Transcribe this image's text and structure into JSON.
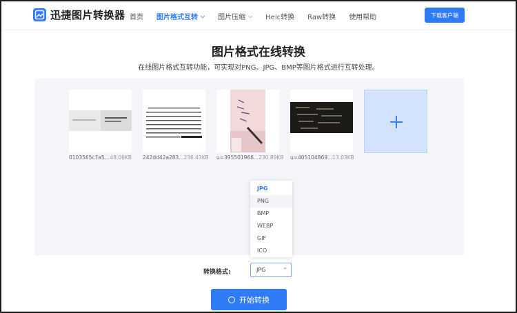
{
  "header": {
    "logo_text": "迅捷图片转换器",
    "nav": [
      {
        "label": "首页",
        "active": false,
        "caret": false
      },
      {
        "label": "图片格式互转",
        "active": true,
        "caret": true
      },
      {
        "label": "图片压缩",
        "active": false,
        "caret": true
      },
      {
        "label": "Heic转换",
        "active": false,
        "caret": false
      },
      {
        "label": "Raw转换",
        "active": false,
        "caret": false
      },
      {
        "label": "使用帮助",
        "active": false,
        "caret": false
      }
    ],
    "download_label": "下载客户端"
  },
  "main": {
    "title": "图片格式在线转换",
    "subtitle": "在线图片格式互转功能，可实现对PNG、JPG、BMP等图片格式进行互转处理。"
  },
  "files": [
    {
      "name": "0103565c7a5...",
      "size": "48.06KB"
    },
    {
      "name": "242dd42a283...",
      "size": "236.43KB"
    },
    {
      "name": "u=395501966...",
      "size": "230.89KB"
    },
    {
      "name": "u=405104869...",
      "size": "13.03KB"
    }
  ],
  "format": {
    "label": "转换格式:",
    "selected": "JPG",
    "options": [
      "JPG",
      "PNG",
      "BMP",
      "WEBP",
      "GIF",
      "ICO"
    ],
    "hover_index": 1
  },
  "start_label": "开始转换",
  "colors": {
    "accent": "#2f7bf5",
    "area_bg": "#f3f5f9",
    "add_bg": "#d3e2fd"
  }
}
